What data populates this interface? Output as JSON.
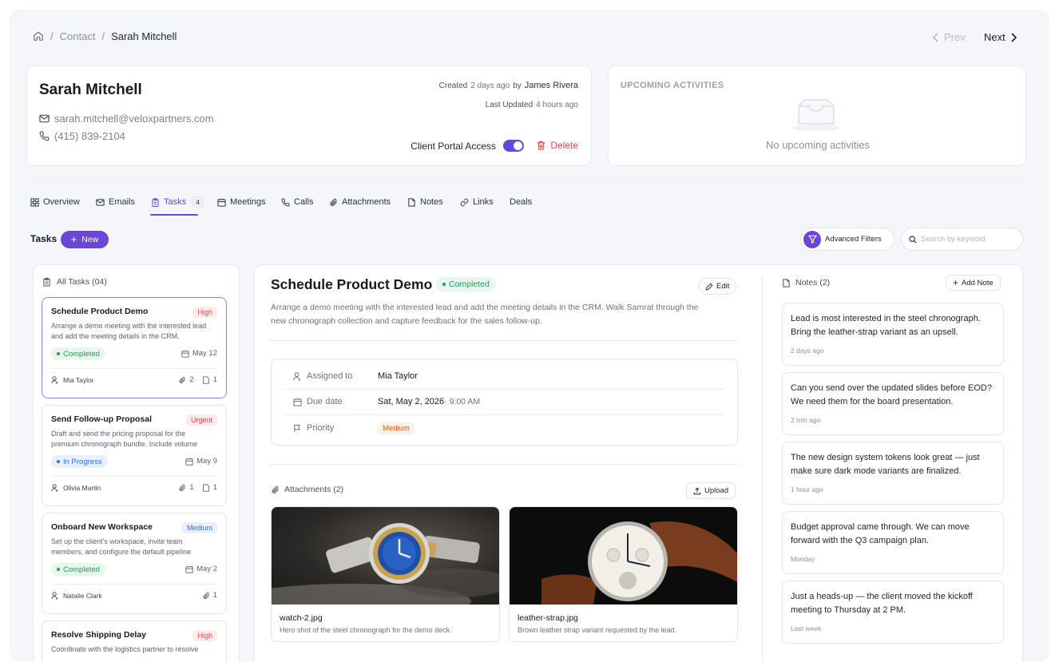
{
  "breadcrumb": {
    "section": "Contact",
    "current": "Sarah Mitchell"
  },
  "pager": {
    "prev": "Prev",
    "next": "Next"
  },
  "contact": {
    "name": "Sarah Mitchell",
    "email": "sarah.mitchell@veloxpartners.com",
    "phone": "(415) 839-2104",
    "created_label": "Created",
    "created_value": "2 days ago",
    "by_label": "by",
    "created_by": "James Rivera",
    "updated_label": "Last Updated",
    "updated_value": "4 hours ago",
    "portal_label": "Client Portal Access",
    "portal_enabled": true,
    "delete_label": "Delete"
  },
  "upcoming": {
    "title": "UPCOMING ACTIVITIES",
    "empty": "No upcoming activities"
  },
  "tabs": [
    {
      "label": "Overview",
      "icon": "grid-icon"
    },
    {
      "label": "Emails",
      "icon": "mail-icon"
    },
    {
      "label": "Tasks",
      "icon": "clipboard-icon",
      "count": "4",
      "active": true
    },
    {
      "label": "Meetings",
      "icon": "calendar-icon"
    },
    {
      "label": "Calls",
      "icon": "phone-icon"
    },
    {
      "label": "Attachments",
      "icon": "paperclip-icon"
    },
    {
      "label": "Notes",
      "icon": "file-icon"
    },
    {
      "label": "Links",
      "icon": "link-icon"
    },
    {
      "label": "Deals",
      "icon": ""
    }
  ],
  "toolbar": {
    "title": "Tasks",
    "new_label": "New",
    "filters_label": "Advanced Filters",
    "search_placeholder": "Search by keyword"
  },
  "task_list": {
    "header": "All Tasks (04)",
    "items": [
      {
        "title": "Schedule Product Demo",
        "priority": "High",
        "desc": "Arrange a demo meeting with the interested lead and add the meeting details in the CRM.",
        "status": "Completed",
        "date": "May 12",
        "owner": "Mia Taylor",
        "attachments": "2",
        "notes": "1"
      },
      {
        "title": "Send Follow-up Proposal",
        "priority": "Urgent",
        "desc": "Draft and send the pricing proposal for the premium chronograph bundle. Include volume",
        "status": "In Progress",
        "date": "May 9",
        "owner": "Olivia Martin",
        "attachments": "1",
        "notes": "1"
      },
      {
        "title": "Onboard New Workspace",
        "priority": "Medium",
        "desc": "Set up the client's workspace, invite team members, and configure the default pipeline",
        "status": "Completed",
        "date": "May 2",
        "owner": "Natalie Clark",
        "attachments": "1",
        "notes": ""
      },
      {
        "title": "Resolve Shipping Delay",
        "priority": "High",
        "desc": "Coordinate with the logistics partner to resolve"
      }
    ]
  },
  "detail": {
    "title": "Schedule Product Demo",
    "status": "Completed",
    "edit_label": "Edit",
    "description": "Arrange a demo meeting with the interested lead and add the meeting details in the CRM. Walk Samrat through the new chronograph collection and capture feedback for the sales follow-up.",
    "assigned_label": "Assigned to",
    "assigned_value": "Mia Taylor",
    "due_label": "Due date",
    "due_value": "Sat, May 2, 2026",
    "due_time": "· 9:00 AM",
    "priority_label": "Priority",
    "priority_value": "Medium",
    "attachments_header": "Attachments (2)",
    "upload_label": "Upload",
    "attachments": [
      {
        "name": "watch-2.jpg",
        "caption": "Hero shot of the steel chronograph for the demo deck."
      },
      {
        "name": "leather-strap.jpg",
        "caption": "Brown leather strap variant requested by the lead."
      }
    ]
  },
  "notes": {
    "header": "Notes (2)",
    "add_label": "Add Note",
    "items": [
      {
        "text": "Lead is most interested in the steel chronograph. Bring the leather-strap variant as an upsell.",
        "time": "2 days ago"
      },
      {
        "text": "Can you send over the updated slides before EOD? We need them for the board presentation.",
        "time": "2 min ago"
      },
      {
        "text": "The new design system tokens look great — just make sure dark mode variants are finalized.",
        "time": "1 hour ago"
      },
      {
        "text": "Budget approval came through. We can move forward with the Q3 campaign plan.",
        "time": "Monday"
      },
      {
        "text": "Just a heads-up — the client moved the kickoff meeting to Thursday at 2 PM.",
        "time": "Last week"
      }
    ]
  },
  "colors": {
    "accent": "#6b46d9",
    "high": "#e5484d",
    "medium": "#3b6fe0",
    "completed": "#1f9d55",
    "progress": "#2f6fe4"
  }
}
